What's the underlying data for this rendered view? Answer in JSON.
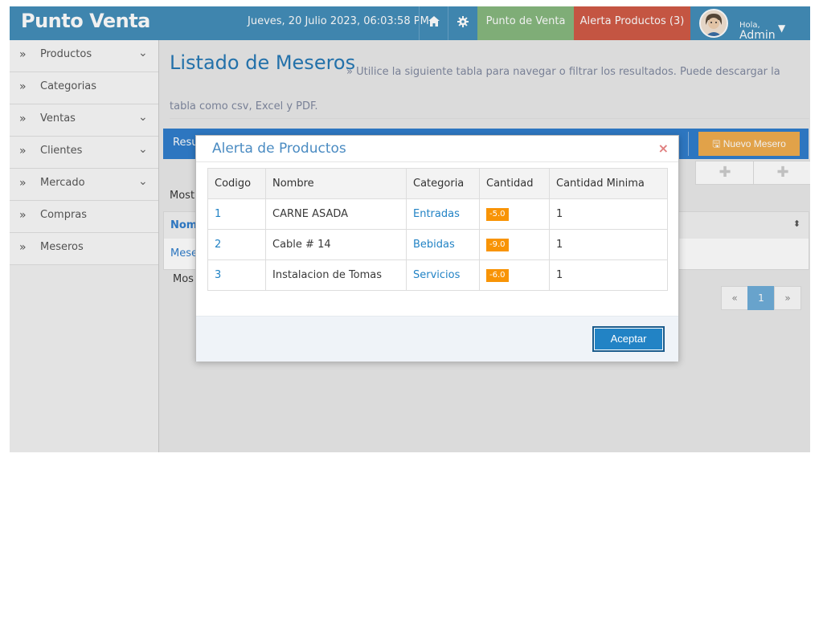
{
  "navbar": {
    "brand": "Punto Venta",
    "datetime": "Jueves, 20 Julio 2023, 06:03:58 PM",
    "home_icon": "home-icon",
    "settings_icon": "gear-icon",
    "pos_label": "Punto de Venta",
    "alert_label": "Alerta Productos (3)",
    "user_greeting": "Hola,",
    "user_name": "Admin"
  },
  "sidebar": {
    "items": [
      {
        "label": "Productos",
        "has_submenu": true
      },
      {
        "label": "Categorias",
        "has_submenu": false
      },
      {
        "label": "Ventas",
        "has_submenu": true
      },
      {
        "label": "Clientes",
        "has_submenu": true
      },
      {
        "label": "Mercado",
        "has_submenu": true
      },
      {
        "label": "Compras",
        "has_submenu": false
      },
      {
        "label": "Meseros",
        "has_submenu": false
      }
    ]
  },
  "main": {
    "title": "Listado de Meseros",
    "description": "» Utilice la siguiente tabla para navegar o filtrar los resultados. Puede descargar la tabla como csv, Excel y PDF.",
    "results_bar_label": "Resu",
    "new_button_label": "Nuevo Mesero",
    "showing_top": "Most",
    "table_header": "Nom",
    "row_value": "Mese",
    "showing_bottom": "Mos",
    "pagination": {
      "prev": "«",
      "current": "1",
      "next": "»"
    }
  },
  "modal": {
    "title": "Alerta de Productos",
    "close": "×",
    "columns": [
      "Codigo",
      "Nombre",
      "Categoria",
      "Cantidad",
      "Cantidad Minima"
    ],
    "rows": [
      {
        "codigo": "1",
        "nombre": "CARNE ASADA",
        "categoria": "Entradas",
        "cantidad": "-5.0",
        "minima": "1"
      },
      {
        "codigo": "2",
        "nombre": "Cable # 14",
        "categoria": "Bebidas",
        "cantidad": "-9.0",
        "minima": "1"
      },
      {
        "codigo": "3",
        "nombre": "Instalacion de Tomas",
        "categoria": "Servicios",
        "cantidad": "-6.0",
        "minima": "1"
      }
    ],
    "accept_label": "Aceptar"
  },
  "colors": {
    "navbar": "#438eb9",
    "pos_button": "#87b87f",
    "alert_button": "#d15b47",
    "new_button": "#f0ad4e",
    "quantity_badge": "#f89406",
    "primary": "#2283c5"
  }
}
